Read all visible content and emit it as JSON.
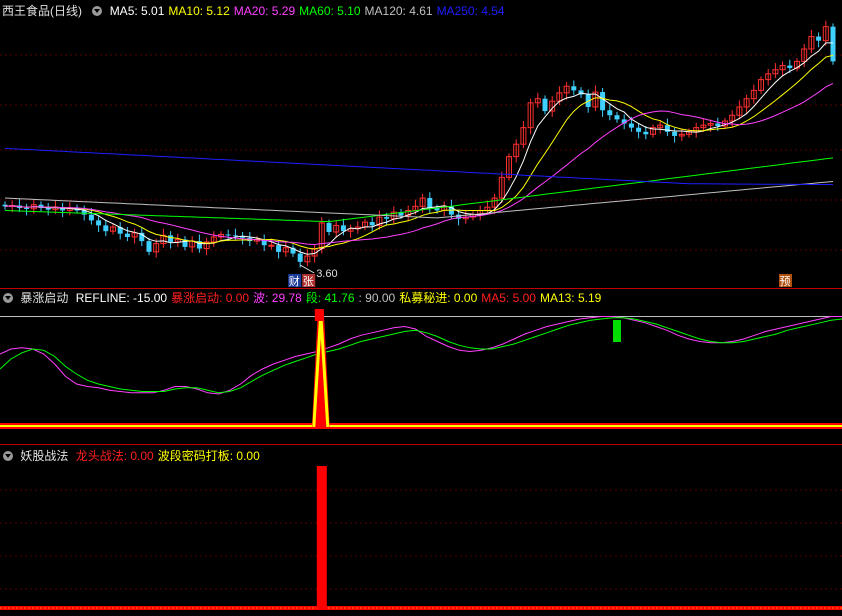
{
  "main": {
    "title": "西王食品(日线)",
    "ma": [
      {
        "label": "MA5:",
        "value": "5.01",
        "color": "#ffffff"
      },
      {
        "label": "MA10:",
        "value": "5.12",
        "color": "#ffff00"
      },
      {
        "label": "MA20:",
        "value": "5.29",
        "color": "#ff40ff"
      },
      {
        "label": "MA60:",
        "value": "5.10",
        "color": "#00ff00"
      },
      {
        "label": "MA120:",
        "value": "4.61",
        "color": "#c0c0c0"
      },
      {
        "label": "MA250:",
        "value": "4.54",
        "color": "#1e1eff"
      }
    ],
    "low_label": "3.60",
    "markers": [
      "财",
      "张",
      "预"
    ]
  },
  "ind1": {
    "title": "暴涨启动",
    "items": [
      {
        "label": "REFLINE:",
        "value": "-15.00",
        "color": "#ffffff"
      },
      {
        "label": "暴涨启动:",
        "value": "0.00",
        "color": "#ff2020"
      },
      {
        "label": "波:",
        "value": "29.78",
        "color": "#ff40ff"
      },
      {
        "label": "段:",
        "value": "41.76",
        "color": "#00ff00"
      },
      {
        "label": ":",
        "value": "90.00",
        "color": "#c0c0c0"
      },
      {
        "label": "私募秘进:",
        "value": "0.00",
        "color": "#ffff00"
      },
      {
        "label": "MA5:",
        "value": "5.00",
        "color": "#ff2020"
      },
      {
        "label": "MA13:",
        "value": "5.19",
        "color": "#ffff00"
      }
    ]
  },
  "ind2": {
    "title": "妖股战法",
    "items": [
      {
        "label": "龙头战法:",
        "value": "0.00",
        "color": "#ff2020"
      },
      {
        "label": "波段密码打板:",
        "value": "0.00",
        "color": "#ffff00"
      }
    ]
  },
  "chart_data": {
    "type": "candlestick",
    "candle_colors": {
      "up": "#ff3030",
      "down": "#40d0ff"
    },
    "price_range": [
      3.4,
      6.6
    ],
    "closes": [
      4.35,
      4.36,
      4.33,
      4.32,
      4.37,
      4.33,
      4.31,
      4.34,
      4.3,
      4.33,
      4.3,
      4.25,
      4.18,
      4.12,
      4.05,
      4.1,
      4.02,
      3.98,
      4.03,
      3.93,
      3.8,
      3.9,
      4.0,
      3.92,
      3.95,
      3.86,
      3.93,
      3.84,
      3.92,
      3.98,
      4.01,
      4.0,
      3.99,
      3.97,
      3.93,
      3.95,
      3.88,
      3.88,
      3.8,
      3.85,
      3.78,
      3.68,
      3.75,
      3.84,
      4.15,
      4.04,
      4.12,
      4.05,
      4.08,
      4.1,
      4.16,
      4.12,
      4.22,
      4.2,
      4.28,
      4.24,
      4.3,
      4.35,
      4.45,
      4.33,
      4.3,
      4.35,
      4.25,
      4.2,
      4.22,
      4.25,
      4.3,
      4.34,
      4.45,
      4.7,
      4.95,
      5.1,
      5.3,
      5.6,
      5.65,
      5.5,
      5.62,
      5.72,
      5.8,
      5.75,
      5.7,
      5.55,
      5.73,
      5.51,
      5.45,
      5.4,
      5.35,
      5.3,
      5.25,
      5.22,
      5.3,
      5.33,
      5.25,
      5.2,
      5.22,
      5.25,
      5.3,
      5.33,
      5.35,
      5.32,
      5.38,
      5.45,
      5.55,
      5.65,
      5.75,
      5.88,
      5.95,
      6.0,
      6.05,
      6.02,
      6.1,
      6.25,
      6.4,
      6.35,
      6.52,
      6.1
    ],
    "ma_colors": {
      "MA5": "#ffffff",
      "MA10": "#ffff00",
      "MA20": "#ff40ff",
      "MA60": "#00ff00",
      "MA120": "#c0c0c0",
      "MA250": "#1e1eff"
    },
    "indicator1": {
      "series": [
        {
          "name": "波",
          "color": "#ff40ff",
          "values": [
            60,
            64,
            65,
            64,
            60,
            52,
            42,
            36,
            34,
            33,
            31,
            30,
            29,
            29,
            29,
            31,
            34,
            34,
            32,
            29,
            28,
            31,
            36,
            43,
            48,
            52,
            55,
            58,
            60,
            62,
            65,
            68,
            72,
            75,
            77,
            79,
            81,
            82,
            80,
            74,
            70,
            66,
            63,
            62,
            63,
            65,
            68,
            72,
            76,
            79,
            82,
            84,
            86,
            88,
            89,
            90,
            90,
            89,
            87,
            85,
            82,
            79,
            75,
            72,
            70,
            69,
            69,
            70,
            72,
            75,
            78,
            80,
            82,
            84,
            86,
            88,
            90,
            90
          ]
        },
        {
          "name": "段",
          "color": "#00ff00",
          "values": [
            48,
            56,
            61,
            64,
            63,
            58,
            50,
            44,
            39,
            36,
            34,
            32,
            31,
            30,
            30,
            30,
            32,
            33,
            33,
            31,
            29,
            30,
            33,
            38,
            43,
            47,
            51,
            54,
            57,
            60,
            62,
            64,
            67,
            70,
            72,
            74,
            76,
            78,
            79,
            77,
            74,
            70,
            67,
            65,
            64,
            64,
            66,
            68,
            71,
            74,
            77,
            80,
            83,
            85,
            87,
            88,
            89,
            89,
            88,
            86,
            84,
            81,
            78,
            75,
            72,
            70,
            69,
            69,
            70,
            72,
            74,
            76,
            79,
            81,
            83,
            85,
            87,
            88
          ]
        }
      ],
      "surge_spike_x": 44,
      "green_markers_x": [
        85,
        120
      ]
    },
    "indicator2": {
      "spike_x": 44
    }
  }
}
